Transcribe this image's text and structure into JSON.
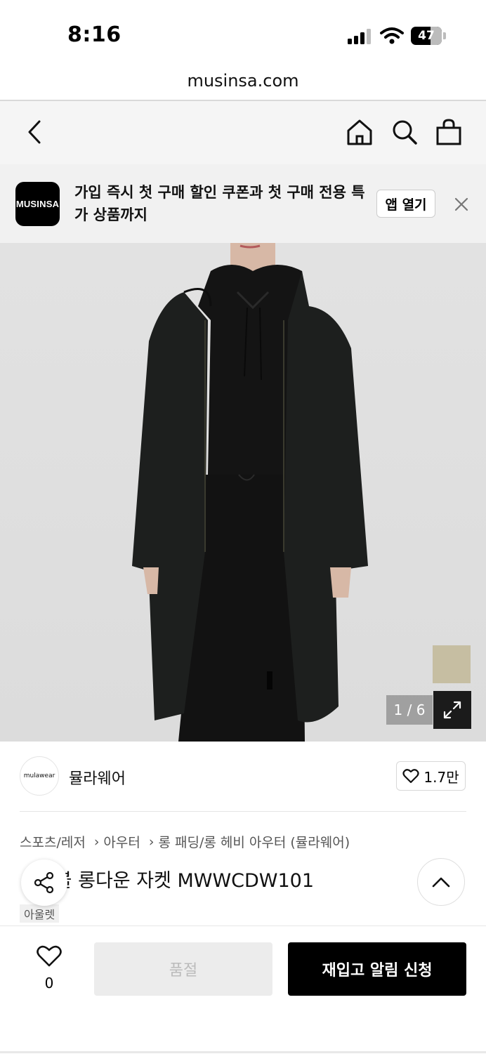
{
  "status_bar": {
    "time": "8:16",
    "battery": "47"
  },
  "browser": {
    "url": "musinsa.com"
  },
  "nav": {
    "icons": [
      "back-icon",
      "home-icon",
      "search-icon",
      "bag-icon"
    ]
  },
  "app_banner": {
    "logo_text": "MUSINSA",
    "message": "가입 즉시 첫 구매 할인 쿠폰과 첫 구매 전용 특가 상품까지",
    "open_app_label": "앱 열기"
  },
  "gallery": {
    "counter": "1 / 6",
    "swatch_color": "#c6bea2"
  },
  "brand": {
    "logo_text": "mulawear",
    "name": "뮬라웨어",
    "likes": "1.7만"
  },
  "breadcrumb": [
    "스포츠/레저",
    "아우터",
    "롱 패딩/롱 헤비 아우터 (뮬라웨어)"
  ],
  "product": {
    "title": "ㄱ비블 롱다운 자켓 MWWCDW101",
    "badge": "아울렛"
  },
  "bottom_bar": {
    "wishlist_count": "0",
    "soldout_label": "품절",
    "restock_label": "재입고 알림 신청"
  },
  "colors": {
    "accent": "#000000",
    "disabled": "#ececec"
  }
}
